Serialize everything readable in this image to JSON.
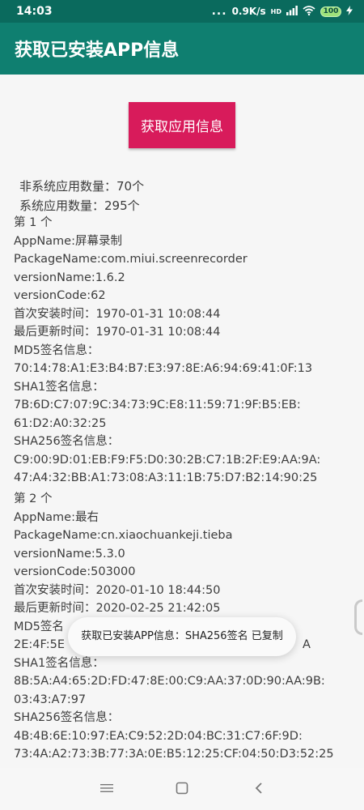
{
  "status_bar": {
    "time": "14:03",
    "dots": "...",
    "network_speed": "0.9K/s",
    "network_tag": "HD",
    "battery": "100"
  },
  "app_bar": {
    "title": "获取已安装APP信息"
  },
  "main": {
    "button_label": "获取应用信息",
    "non_system_count": "非系统应用数量：70个",
    "system_count": "系统应用数量：295个",
    "apps": [
      {
        "index": "第 1 个",
        "app_name": "AppName:屏幕录制",
        "package_name": "PackageName:com.miui.screenrecorder",
        "version_name": "versionName:1.6.2",
        "version_code": "versionCode:62",
        "first_install": "首次安装时间：1970-01-31 10:08:44",
        "last_update": "最后更新时间：1970-01-31 10:08:44",
        "md5_label": "MD5签名信息：",
        "md5": "70:14:78:A1:E3:B4:B7:E3:97:8E:A6:94:69:41:0F:13",
        "sha1_label": "SHA1签名信息：",
        "sha1_line1": "7B:6D:C7:07:9C:34:73:9C:E8:11:59:71:9F:B5:EB:",
        "sha1_line2": "61:D2:A0:32:25",
        "sha256_label": "SHA256签名信息：",
        "sha256_line1": "C9:00:9D:01:EB:F9:F5:D0:30:2B:C7:1B:2F:E9:AA:9A:",
        "sha256_line2": "47:A4:32:BB:A1:73:08:A3:11:1B:75:D7:B2:14:90:25"
      },
      {
        "index": "第 2 个",
        "app_name": "AppName:最右",
        "package_name": "PackageName:cn.xiaochuankeji.tieba",
        "version_name": "versionName:5.3.0",
        "version_code": "versionCode:503000",
        "first_install": "首次安装时间：2020-01-10 18:44:50",
        "last_update": "最后更新时间：2020-02-25 21:42:05",
        "md5_label": "MD5签名",
        "md5": "2E:4F:5E",
        "md5_tail": "A",
        "sha1_label": "SHA1签名信息：",
        "sha1_line1": "8B:5A:A4:65:2D:FD:47:8E:00:C9:AA:37:0D:90:AA:9B:",
        "sha1_line2": "03:43:A7:97",
        "sha256_label": "SHA256签名信息：",
        "sha256_line1": "4B:4B:6E:10:97:EA:C9:52:2D:04:BC:31:C7:6F:9D:",
        "sha256_line2": "73:4A:A2:73:3B:77:3A:0E:B5:12:25:CF:04:50:D3:52:25"
      }
    ]
  },
  "toast": {
    "text": "获取已安装APP信息：SHA256签名 已复制"
  },
  "nav_bar": {
    "menu_icon": "menu-icon",
    "home_icon": "home-square-icon",
    "back_icon": "back-chevron-icon"
  }
}
